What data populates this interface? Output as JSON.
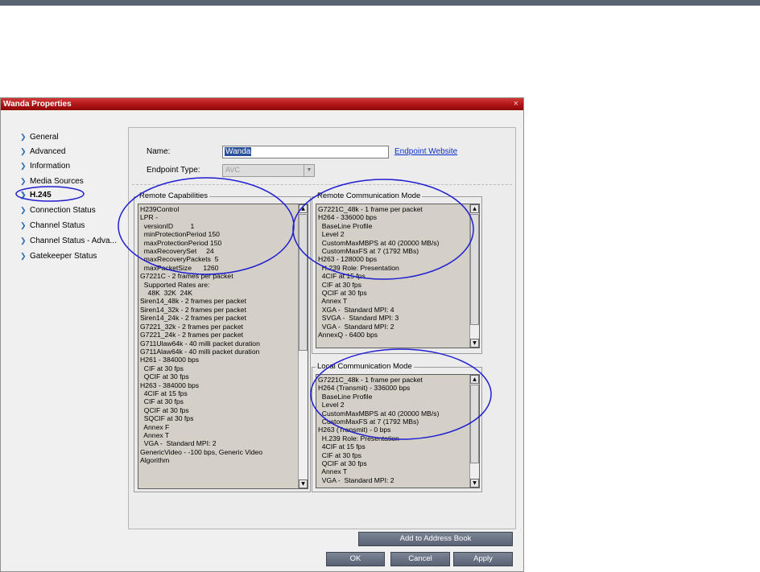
{
  "window": {
    "title": "Wanda Properties",
    "close_glyph": "×"
  },
  "nav": {
    "items": [
      {
        "label": "General"
      },
      {
        "label": "Advanced"
      },
      {
        "label": "Information"
      },
      {
        "label": "Media Sources"
      },
      {
        "label": "H.245",
        "active": true
      },
      {
        "label": "Connection Status"
      },
      {
        "label": "Channel Status"
      },
      {
        "label": "Channel Status - Adva..."
      },
      {
        "label": "Gatekeeper Status"
      }
    ]
  },
  "form": {
    "name_label": "Name:",
    "name_value": "Wanda",
    "endpoint_website_link": "Endpoint Website",
    "endpoint_type_label": "Endpoint Type:",
    "endpoint_type_value": "AVC"
  },
  "remote_capabilities": {
    "title": "Remote Capabilities",
    "lines": [
      "H239Control",
      "LPR -",
      "  versionID         1",
      "  minProtectionPeriod 150",
      "  maxProtectionPeriod 150",
      "  maxRecoverySet     24",
      "  maxRecoveryPackets  5",
      "  maxPacketSize      1260",
      "G7221C - 2 frames per packet",
      "  Supported Rates are:",
      "    48K  32K  24K",
      "Siren14_48k - 2 frames per packet",
      "Siren14_32k - 2 frames per packet",
      "Siren14_24k - 2 frames per packet",
      "G7221_32k - 2 frames per packet",
      "G7221_24k - 2 frames per packet",
      "G711Ulaw64k - 40 milli packet duration",
      "G711Alaw64k - 40 milli packet duration",
      "H261 - 384000 bps",
      "  CIF at 30 fps",
      "  QCIF at 30 fps",
      "H263 - 384000 bps",
      "  4CIF at 15 fps",
      "  CIF at 30 fps",
      "  QCIF at 30 fps",
      "  SQCIF at 30 fps",
      "  Annex F",
      "  Annex T",
      "  VGA -  Standard MPI: 2",
      "GenericVideo - -100 bps, Generic Video",
      "Algorithm"
    ]
  },
  "remote_comm_mode": {
    "title": "Remote Communication Mode",
    "lines": [
      "G7221C_48k - 1 frame per packet",
      "H264 - 336000 bps",
      "  BaseLine Profile",
      "  Level 2",
      "  CustomMaxMBPS at 40 (20000 MB/s)",
      "  CustomMaxFS at 7 (1792 MBs)",
      "H263 - 128000 bps",
      "  H.239 Role: Presentation",
      "  4CIF at 15 fps",
      "  CIF at 30 fps",
      "  QCIF at 30 fps",
      "  Annex T",
      "  XGA -  Standard MPI: 4",
      "  SVGA -  Standard MPI: 3",
      "  VGA -  Standard MPI: 2",
      "AnnexQ - 6400 bps"
    ]
  },
  "local_comm_mode": {
    "title": "Local Communication Mode",
    "lines": [
      "G7221C_48k - 1 frame per packet",
      "H264 (Transmit) - 336000 bps",
      "  BaseLine Profile",
      "  Level 2",
      "  CustomMaxMBPS at 40 (20000 MB/s)",
      "  CustomMaxFS at 7 (1792 MBs)",
      "H263 (Transmit) - 0 bps",
      "  H.239 Role: Presentation",
      "  4CIF at 15 fps",
      "  CIF at 30 fps",
      "  QCIF at 30 fps",
      "  Annex T",
      "  VGA -  Standard MPI: 2"
    ]
  },
  "buttons": {
    "add_to_address_book": "Add to Address Book",
    "ok": "OK",
    "cancel": "Cancel",
    "apply": "Apply"
  },
  "scroll_glyphs": {
    "up": "▲",
    "down": "▼"
  },
  "colors": {
    "title_bar": "#b01414",
    "annotation": "#1f1fd0",
    "link": "#0b2fcc",
    "button": "#5a6375"
  }
}
